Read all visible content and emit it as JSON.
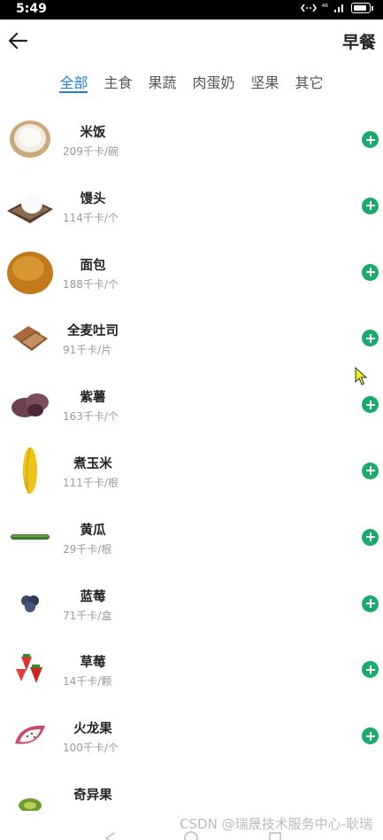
{
  "status_bar": {
    "time": "5:49",
    "signal_label": "⁴⁶",
    "battery_level": 0.9
  },
  "header": {
    "title": "早餐",
    "back_icon": "arrow-left-icon"
  },
  "tabs": [
    {
      "label": "全部",
      "active": true
    },
    {
      "label": "主食",
      "active": false
    },
    {
      "label": "果蔬",
      "active": false
    },
    {
      "label": "肉蛋奶",
      "active": false
    },
    {
      "label": "坚果",
      "active": false
    },
    {
      "label": "其它",
      "active": false
    }
  ],
  "foods": [
    {
      "name": "米饭",
      "calories": "209千卡/碗",
      "icon": "rice-bowl-icon"
    },
    {
      "name": "馒头",
      "calories": "114千卡/个",
      "icon": "steamed-bun-icon"
    },
    {
      "name": "面包",
      "calories": "188千卡/个",
      "icon": "bread-icon"
    },
    {
      "name": "全麦吐司",
      "calories": "91千卡/片",
      "icon": "toast-icon"
    },
    {
      "name": "紫薯",
      "calories": "163千卡/个",
      "icon": "purple-potato-icon"
    },
    {
      "name": "煮玉米",
      "calories": "111千卡/根",
      "icon": "corn-icon"
    },
    {
      "name": "黄瓜",
      "calories": "29千卡/根",
      "icon": "cucumber-icon"
    },
    {
      "name": "蓝莓",
      "calories": "71千卡/盒",
      "icon": "blueberry-icon"
    },
    {
      "name": "草莓",
      "calories": "14千卡/颗",
      "icon": "strawberry-icon"
    },
    {
      "name": "火龙果",
      "calories": "100千卡/个",
      "icon": "dragon-fruit-icon"
    },
    {
      "name": "奇异果",
      "calories": "",
      "icon": "kiwi-icon"
    }
  ],
  "watermark": "CSDN @瑞晟技术服务中心-耿瑞",
  "colors": {
    "accent": "#1e7fd6",
    "add": "#1aaa6c"
  }
}
